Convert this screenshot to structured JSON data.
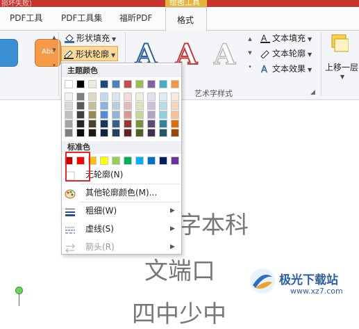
{
  "titlebar": {
    "title_fragment": "损坏失败)",
    "context_group": "绘图工具"
  },
  "tabs": [
    {
      "label": "PDF工具"
    },
    {
      "label": "PDF工具集"
    },
    {
      "label": "福昕PDF"
    },
    {
      "label": "格式",
      "active": true
    }
  ],
  "ribbon": {
    "shape_style_sample": "Abc",
    "shape_fill": "形状填充",
    "shape_outline": "形状轮廓",
    "text_fill": "文本填充",
    "text_outline": "文本轮廓",
    "text_effects": "文本效果",
    "wordart_styles": "艺术字样式",
    "bring_forward": "上移一层",
    "wordart_glyph": "A"
  },
  "menu": {
    "theme_colors_header": "主题颜色",
    "standard_colors_header": "标准色",
    "no_outline": "无轮廓(N)",
    "more_colors": "其他轮廓颜色(M)...",
    "weight": "粗细(W)",
    "dashes": "虚线(S)",
    "arrows": "箭头(R)",
    "theme_top_row": [
      "#ffffff",
      "#000000",
      "#eeece1",
      "#1f497d",
      "#4f81bd",
      "#c0504d",
      "#9bbb59",
      "#8064a2",
      "#4bacc6",
      "#f79646"
    ],
    "theme_shades": [
      [
        "#f2f2f2",
        "#7f7f7f",
        "#ddd9c3",
        "#c6d9f0",
        "#dbe5f1",
        "#f2dcdb",
        "#ebf1dd",
        "#e5e0ec",
        "#dbeef3",
        "#fdeada"
      ],
      [
        "#d8d8d8",
        "#595959",
        "#c4bd97",
        "#8db3e2",
        "#b8cce4",
        "#e5b9b7",
        "#d7e3bc",
        "#ccc1d9",
        "#b7dde8",
        "#fbd5b5"
      ],
      [
        "#bfbfbf",
        "#3f3f3f",
        "#938953",
        "#548dd4",
        "#95b3d7",
        "#d99694",
        "#c3d69b",
        "#b2a2c7",
        "#92cddc",
        "#fac08f"
      ],
      [
        "#a5a5a5",
        "#262626",
        "#494429",
        "#17365d",
        "#366092",
        "#953734",
        "#76923c",
        "#5f497a",
        "#31859b",
        "#e36c09"
      ],
      [
        "#7f7f7f",
        "#0c0c0c",
        "#1d1b10",
        "#0f243e",
        "#244061",
        "#632423",
        "#4f6128",
        "#3f3151",
        "#205867",
        "#974806"
      ]
    ],
    "standard": [
      "#c00000",
      "#ff0000",
      "#ffc000",
      "#ffff00",
      "#92d050",
      "#00b050",
      "#00b0f0",
      "#0070c0",
      "#002060",
      "#7030a0"
    ]
  },
  "document": {
    "line1": "字本科",
    "line2": "文端口",
    "line3": "四中少中"
  },
  "watermark": {
    "name": "极光下载站",
    "url": "www.xz7.com"
  }
}
